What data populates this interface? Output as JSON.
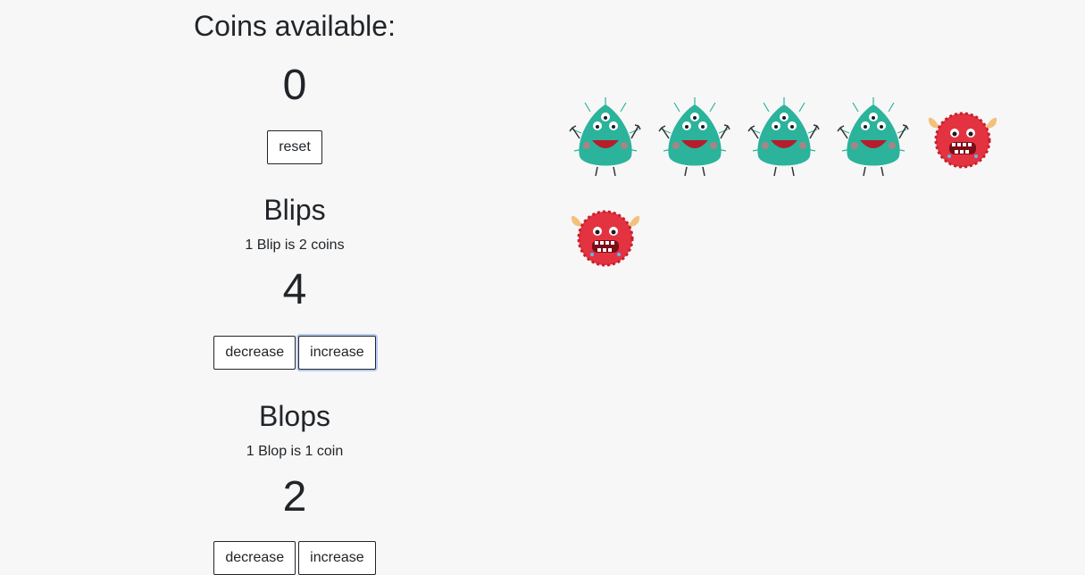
{
  "coins": {
    "heading": "Coins available:",
    "value": "0",
    "reset_label": "reset"
  },
  "blips": {
    "heading": "Blips",
    "rate": "1 Blip is 2 coins",
    "count": "4",
    "decrease_label": "decrease",
    "increase_label": "increase"
  },
  "blops": {
    "heading": "Blops",
    "rate": "1 Blop is 1 coin",
    "count": "2",
    "decrease_label": "decrease",
    "increase_label": "increase"
  },
  "monsters": {
    "blip_icon": "green-three-eyed-monster",
    "blop_icon": "red-furry-monster",
    "blip_color": "#2bb39c",
    "blop_color": "#e43340"
  }
}
